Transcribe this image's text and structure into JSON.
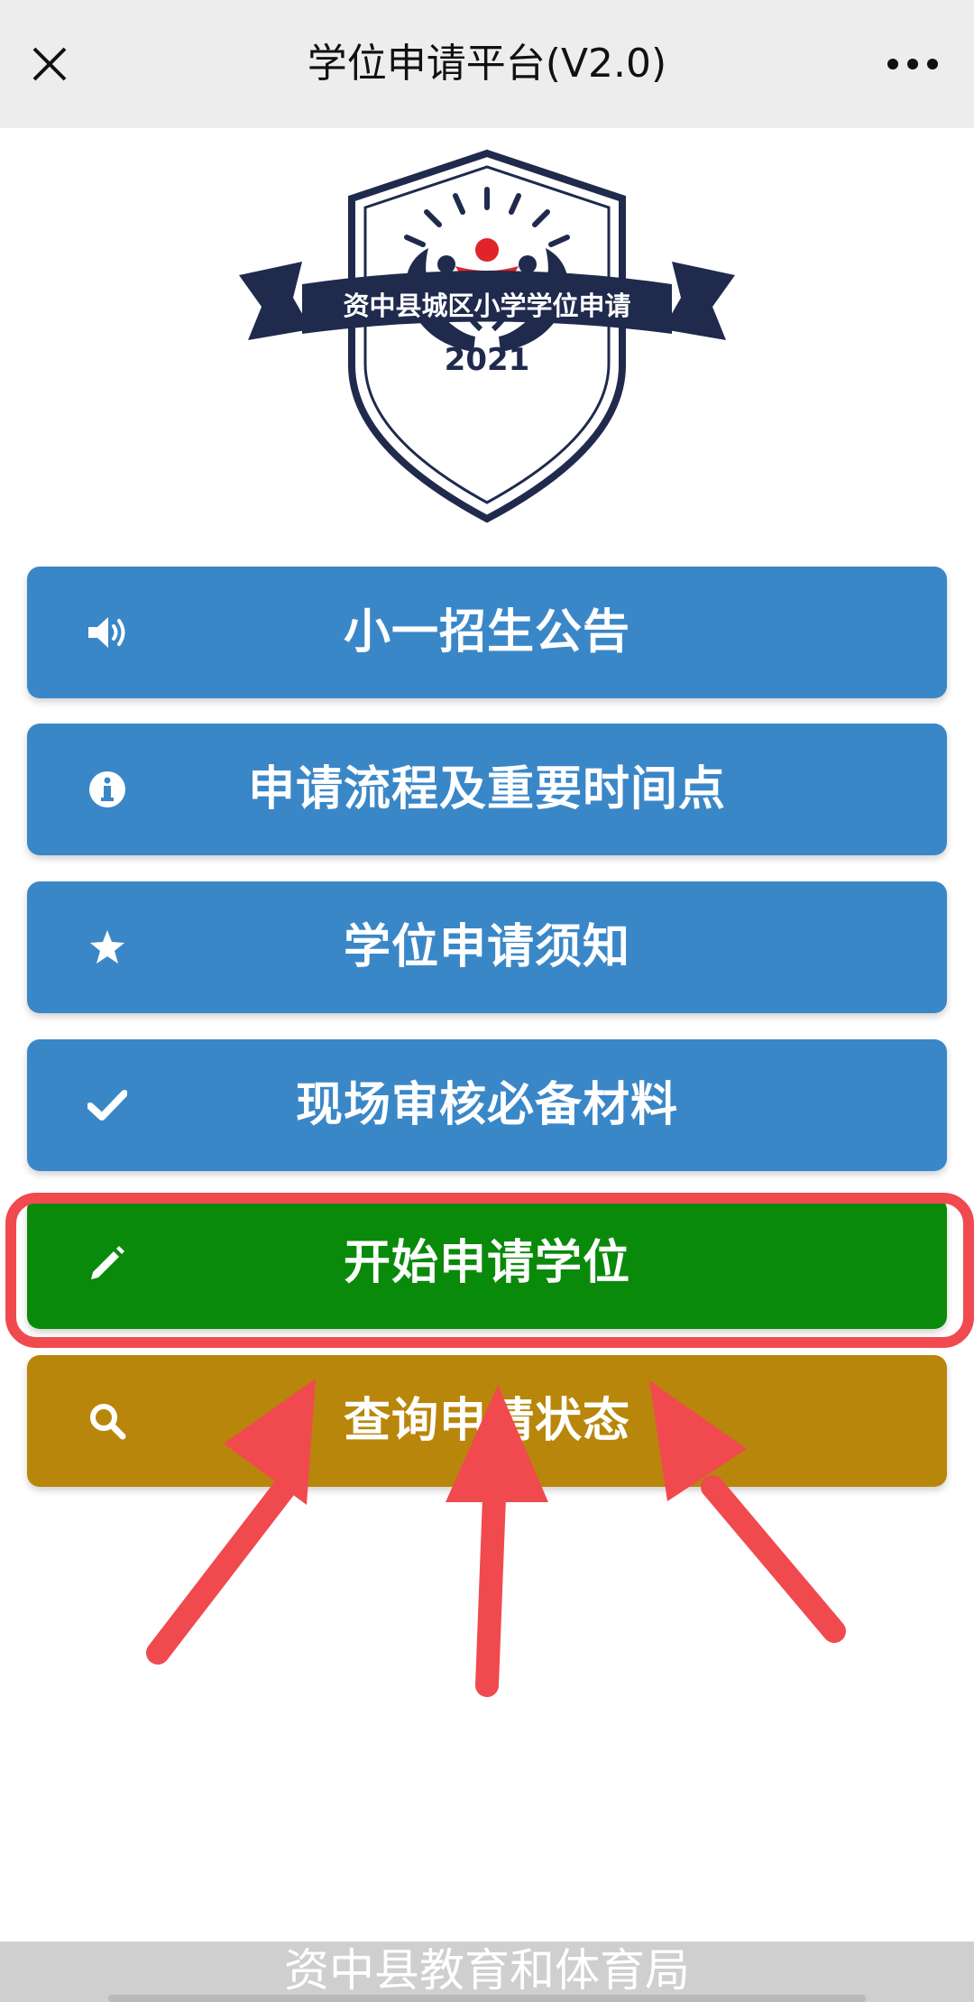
{
  "header": {
    "title": "学位申请平台(V2.0)",
    "close_icon": "close-icon",
    "more_icon": "more-dots-icon"
  },
  "emblem": {
    "banner_text": "资中县城区小学学位申请",
    "year": "2021",
    "colors": {
      "navy": "#1f2a4d",
      "red": "#e0242b"
    }
  },
  "menu": [
    {
      "label": "小一招生公告",
      "icon": "speaker-icon",
      "color": "#3a87c8"
    },
    {
      "label": "申请流程及重要时间点",
      "icon": "info-icon",
      "color": "#3a87c8"
    },
    {
      "label": "学位申请须知",
      "icon": "star-icon",
      "color": "#3a87c8"
    },
    {
      "label": "现场审核必备材料",
      "icon": "check-icon",
      "color": "#3a87c8"
    },
    {
      "label": "开始申请学位",
      "icon": "pencil-icon",
      "color": "#0a8a0a"
    },
    {
      "label": "查询申请状态",
      "icon": "search-icon",
      "color": "#b8860b"
    }
  ],
  "annotation": {
    "highlight_color": "#f04a4f",
    "arrow_count": 3
  },
  "footer": {
    "text": "资中县教育和体育局"
  }
}
